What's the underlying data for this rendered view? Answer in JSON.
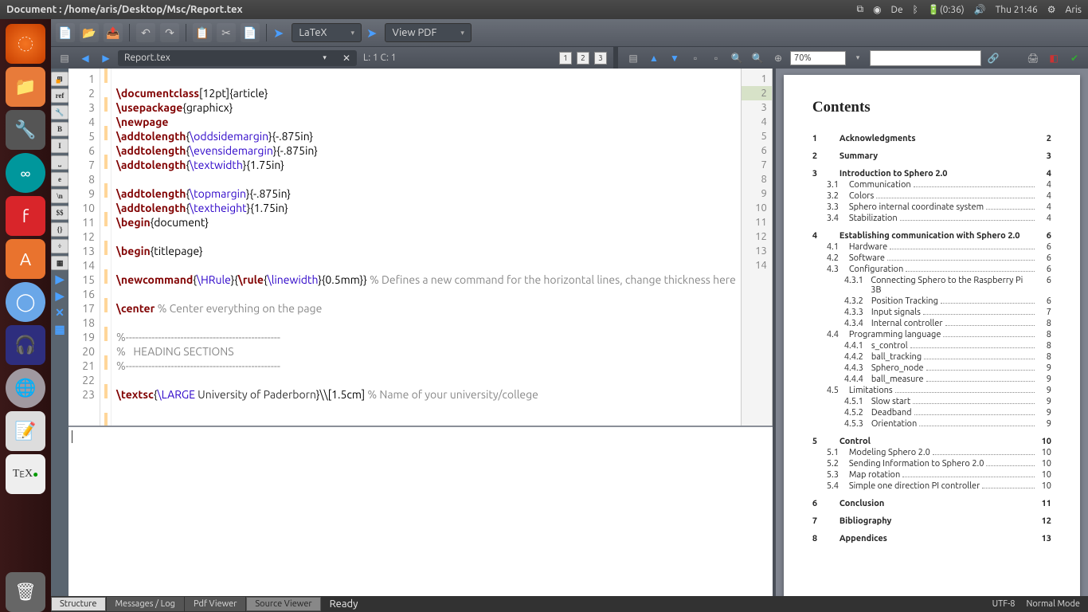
{
  "menubar": {
    "title": "Document : /home/aris/Desktop/Msc/Report.tex",
    "lang": "De",
    "battery": "(0:36)",
    "time": "Thu 21:46",
    "user": "Aris"
  },
  "toolbar": {
    "compile_mode": "LaTeX",
    "view_mode": "View PDF"
  },
  "tab": {
    "filename": "Report.tex",
    "cursor": "L: 1 C: 1",
    "box1": "1",
    "box2": "2",
    "box3": "3",
    "zoom": "70%"
  },
  "sidebar_tools": [
    "⊞",
    "ref",
    "🔧",
    "B",
    "I",
    "⎵",
    "e",
    "\\n",
    "$$",
    "{}",
    "÷",
    "▦"
  ],
  "gutter": [
    "1",
    "2",
    "3",
    "4",
    "5",
    "6",
    "7",
    "8",
    "9",
    "10",
    "11",
    "12",
    "13",
    "14",
    "15",
    "16",
    "17",
    "18",
    "19",
    "20",
    "21",
    "22",
    "23"
  ],
  "gutter2": [
    "1",
    "2",
    "3",
    "4",
    "5",
    "6",
    "7",
    "8",
    "9",
    "10",
    "11",
    "12",
    "13",
    "14"
  ],
  "code_lines": [
    {
      "t": ""
    },
    {
      "html": "<span class='kw'>\\documentclass</span><span class='br'>[12pt]{article}</span>"
    },
    {
      "html": "<span class='kw'>\\usepackage</span><span class='br'>{graphicx}</span>"
    },
    {
      "html": "<span class='kw'>\\newpage</span>"
    },
    {
      "html": "<span class='kw'>\\addtolength</span><span class='br'>{</span><span class='cmd'>\\oddsidemargin</span><span class='br'>}{-.875in}</span>"
    },
    {
      "html": "<span class='kw'>\\addtolength</span><span class='br'>{</span><span class='cmd'>\\evensidemargin</span><span class='br'>}{-.875in}</span>"
    },
    {
      "html": "<span class='kw'>\\addtolength</span><span class='br'>{</span><span class='cmd'>\\textwidth</span><span class='br'>}{1.75in}</span>"
    },
    {
      "t": ""
    },
    {
      "html": "<span class='kw'>\\addtolength</span><span class='br'>{</span><span class='cmd'>\\topmargin</span><span class='br'>}{-.875in}</span>"
    },
    {
      "html": "<span class='kw'>\\addtolength</span><span class='br'>{</span><span class='cmd'>\\textheight</span><span class='br'>}{1.75in}</span>"
    },
    {
      "html": "<span class='kw'>\\begin</span><span class='br'>{document}</span>"
    },
    {
      "t": ""
    },
    {
      "html": "<span class='kw'>\\begin</span><span class='br'>{titlepage}</span>"
    },
    {
      "t": ""
    },
    {
      "html": "<span class='kw'>\\newcommand</span><span class='br'>{</span><span class='cmd'>\\HRule</span><span class='br'>}{</span><span class='kw'>\\rule</span><span class='br'>{</span><span class='cmd'>\\linewidth</span><span class='br'>}{0.5mm}}</span> <span class='cm'>% Defines a new command for the horizontal lines, change thickness here</span>"
    },
    {
      "t": ""
    },
    {
      "html": "<span class='kw'>\\center</span> <span class='cm'>% Center everything on the page</span>"
    },
    {
      "t": ""
    },
    {
      "html": "<span class='cm'>%------------------------------------------------</span>"
    },
    {
      "html": "<span class='cm'>%   HEADING SECTIONS</span>"
    },
    {
      "html": "<span class='cm'>%------------------------------------------------</span>"
    },
    {
      "t": ""
    },
    {
      "html": "<span class='kw'>\\textsc</span><span class='br'>{</span><span class='cmd'>\\LARGE</span> University of Paderborn<span class='br'>}\\\\[1.5cm]</span> <span class='cm'>% Name of your university/college</span>"
    }
  ],
  "pdf": {
    "heading": "Contents",
    "sections": [
      {
        "n": "1",
        "t": "Acknowledgments",
        "p": "2"
      },
      {
        "n": "2",
        "t": "Summary",
        "p": "3"
      },
      {
        "n": "3",
        "t": "Introduction to Sphero 2.0",
        "p": "4",
        "subs": [
          {
            "n": "3.1",
            "t": "Communication",
            "p": "4"
          },
          {
            "n": "3.2",
            "t": "Colors",
            "p": "4"
          },
          {
            "n": "3.3",
            "t": "Sphero internal coordinate system",
            "p": "4"
          },
          {
            "n": "3.4",
            "t": "Stabilization",
            "p": "4"
          }
        ]
      },
      {
        "n": "4",
        "t": "Establishing communication with Sphero 2.0",
        "p": "6",
        "subs": [
          {
            "n": "4.1",
            "t": "Hardware",
            "p": "6"
          },
          {
            "n": "4.2",
            "t": "Software",
            "p": "6"
          },
          {
            "n": "4.3",
            "t": "Configuration",
            "p": "6",
            "subs": [
              {
                "n": "4.3.1",
                "t": "Connecting Sphero to the Raspberry Pi 3B",
                "p": "6"
              },
              {
                "n": "4.3.2",
                "t": "Position Tracking",
                "p": "6"
              },
              {
                "n": "4.3.3",
                "t": "Input signals",
                "p": "7"
              },
              {
                "n": "4.3.4",
                "t": "Internal controller",
                "p": "8"
              }
            ]
          },
          {
            "n": "4.4",
            "t": "Programming language",
            "p": "8",
            "subs": [
              {
                "n": "4.4.1",
                "t": "s_control",
                "p": "8"
              },
              {
                "n": "4.4.2",
                "t": "ball_tracking",
                "p": "8"
              },
              {
                "n": "4.4.3",
                "t": "Sphero_node",
                "p": "9"
              },
              {
                "n": "4.4.4",
                "t": "ball_measure",
                "p": "9"
              }
            ]
          },
          {
            "n": "4.5",
            "t": "Limitations",
            "p": "9",
            "subs": [
              {
                "n": "4.5.1",
                "t": "Slow start",
                "p": "9"
              },
              {
                "n": "4.5.2",
                "t": "Deadband",
                "p": "9"
              },
              {
                "n": "4.5.3",
                "t": "Orientation",
                "p": "9"
              }
            ]
          }
        ]
      },
      {
        "n": "5",
        "t": "Control",
        "p": "10",
        "subs": [
          {
            "n": "5.1",
            "t": "Modeling Sphero 2.0",
            "p": "10"
          },
          {
            "n": "5.2",
            "t": "Sending Information to Sphero 2.0",
            "p": "10"
          },
          {
            "n": "5.3",
            "t": "Map rotation",
            "p": "10"
          },
          {
            "n": "5.4",
            "t": "Simple one direction PI controller",
            "p": "10"
          }
        ]
      },
      {
        "n": "6",
        "t": "Conclusion",
        "p": "11"
      },
      {
        "n": "7",
        "t": "Bibliography",
        "p": "12"
      },
      {
        "n": "8",
        "t": "Appendices",
        "p": "13"
      }
    ]
  },
  "statusbar": {
    "tabs": [
      "Structure",
      "Messages / Log",
      "Pdf Viewer",
      "Source Viewer"
    ],
    "status": "Ready",
    "encoding": "UTF-8",
    "mode": "Normal Mode"
  }
}
